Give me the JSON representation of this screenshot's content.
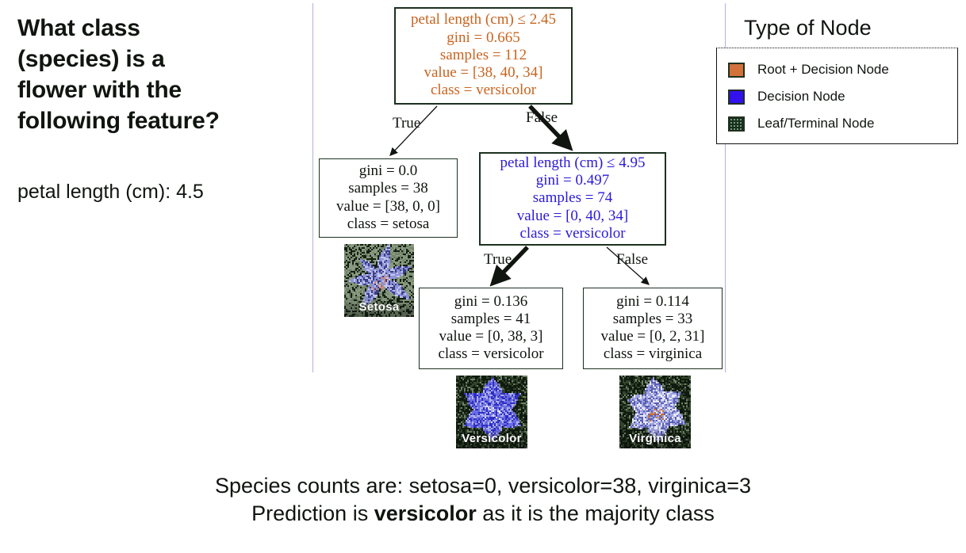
{
  "question": {
    "heading": "What class\n(species) is a\nflower with the\nfollowing feature?",
    "feature": "petal length (cm): 4.5"
  },
  "tree": {
    "root": {
      "condition": "petal length (cm) ≤ 2.45",
      "gini": "gini = 0.665",
      "samples": "samples = 112",
      "value": "value = [38, 40, 34]",
      "class": "class = versicolor",
      "color": "#c8641f"
    },
    "decision": {
      "condition": "petal length (cm) ≤ 4.95",
      "gini": "gini = 0.497",
      "samples": "samples = 74",
      "value": "value = [0, 40, 34]",
      "class": "class = versicolor",
      "color": "#2b1ad6"
    },
    "leaf_setosa": {
      "gini": "gini = 0.0",
      "samples": "samples = 38",
      "value": "value = [38, 0, 0]",
      "class": "class = setosa"
    },
    "leaf_versicolor": {
      "gini": "gini = 0.136",
      "samples": "samples = 41",
      "value": "value = [0, 38, 3]",
      "class": "class = versicolor"
    },
    "leaf_virginica": {
      "gini": "gini = 0.114",
      "samples": "samples = 33",
      "value": "value = [0, 2, 31]",
      "class": "class = virginica"
    },
    "edges": {
      "root_true": "True",
      "root_false": "False",
      "decision_true": "True",
      "decision_false": "False"
    }
  },
  "flowers": {
    "setosa_caption": "Setosa",
    "versicolor_caption": "Versicolor",
    "virginica_caption": "Virginica"
  },
  "legend": {
    "title": "Type of Node",
    "items": [
      {
        "label": "Root + Decision Node",
        "color": "#d2713a"
      },
      {
        "label": "Decision Node",
        "color": "#3311ee"
      },
      {
        "label": "Leaf/Terminal Node",
        "color": "#16301c"
      }
    ]
  },
  "caption": {
    "line1": "Species counts are: setosa=0, versicolor=38, virginica=3",
    "line2_pre": "Prediction is ",
    "line2_bold": "versicolor",
    "line2_post": " as it is the majority class"
  }
}
